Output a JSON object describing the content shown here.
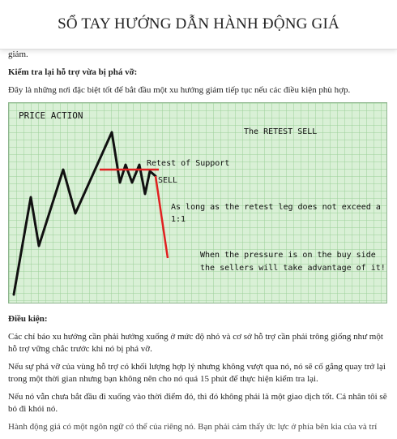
{
  "header": {
    "title": "SỔ TAY HƯỚNG DẪN HÀNH ĐỘNG GIÁ"
  },
  "article": {
    "cut_top_line": "giảm.",
    "section1_heading": "Kiểm tra lại hỗ trợ vừa bị phá vỡ:",
    "section1_paragraph": "Đây là những nơi đặc biệt tốt để bắt đầu một xu hướng giảm tiếp tục nếu các điều kiện phù hợp.",
    "chart": {
      "title": "PRICE ACTION",
      "retest_sell": "The RETEST SELL",
      "retest_support": "Retest of Support",
      "sell_label": "SELL",
      "note1": "As long as the retest leg does not exceed a 1:1",
      "note2_line1": "When the pressure is on the buy side",
      "note2_line2": "the sellers will take advantage of it!"
    },
    "section2_heading": "Điều kiện:",
    "para1": "Các chỉ báo xu hướng cần phải hướng xuống ở mức độ nhỏ và cơ sở hỗ trợ cần phải trông giống như một hỗ trợ vững chắc trước khi nó bị phá vỡ.",
    "para2": "Nếu sự phá vỡ của vùng hỗ trợ có khối lượng hợp lý nhưng không vượt qua nó, nó sẽ cố gắng quay trở lại trong một thời gian nhưng bạn không nên cho nó quá 15 phút để thực hiện kiểm tra lại.",
    "para3": "Nếu nó vẫn chưa bắt đầu đi xuống vào thời điểm đó, thì đó không phải là một giao dịch tốt. Cá nhân tôi sẽ bỏ đi khỏi nó.",
    "para4_cut": "Hành động giá có một ngôn ngữ có thể của riêng nó. Bạn phải cảm thấy ức lực ở phía bên kia của và trí"
  }
}
